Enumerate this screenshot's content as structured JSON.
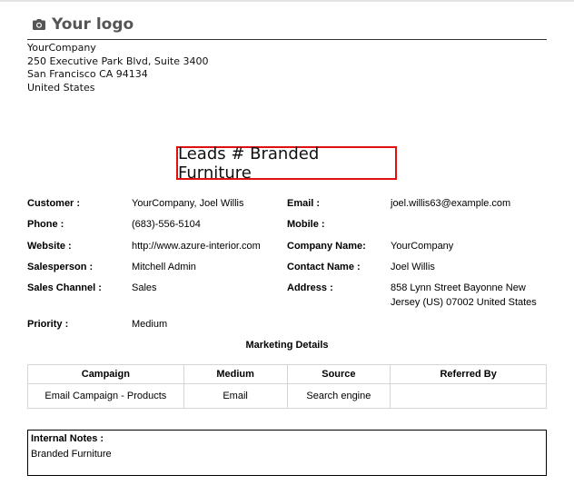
{
  "logo": {
    "text": "Your logo",
    "icon": "camera-icon"
  },
  "company": {
    "name": "YourCompany",
    "street": "250 Executive Park Blvd, Suite 3400",
    "city": "San Francisco CA 94134",
    "country": "United States"
  },
  "title": "Leads # Branded Furniture",
  "fields": {
    "customer": {
      "label": "Customer :",
      "value": "YourCompany, Joel Willis"
    },
    "phone": {
      "label": "Phone :",
      "value": "(683)-556-5104"
    },
    "website": {
      "label": "Website :",
      "value": "http://www.azure-interior.com"
    },
    "salesperson": {
      "label": "Salesperson :",
      "value": "Mitchell Admin"
    },
    "sales_channel": {
      "label": "Sales Channel :",
      "value": "Sales"
    },
    "priority": {
      "label": "Priority :",
      "value": "Medium"
    },
    "email": {
      "label": "Email :",
      "value": "joel.willis63@example.com"
    },
    "mobile": {
      "label": "Mobile :",
      "value": ""
    },
    "company_name": {
      "label": "Company Name:",
      "value": "YourCompany"
    },
    "contact_name": {
      "label": "Contact Name :",
      "value": "Joel Willis"
    },
    "address": {
      "label": "Address :",
      "line1": "858 Lynn Street Bayonne New",
      "line2": "Jersey (US) 07002 United States"
    }
  },
  "marketing": {
    "title": "Marketing Details",
    "headers": [
      "Campaign",
      "Medium",
      "Source",
      "Referred By"
    ],
    "row": [
      "Email Campaign - Products",
      "Email",
      "Search engine",
      ""
    ]
  },
  "notes": {
    "label": "Internal Notes :",
    "value": "Branded Furniture"
  },
  "colors": {
    "title_border": "#e01010"
  }
}
